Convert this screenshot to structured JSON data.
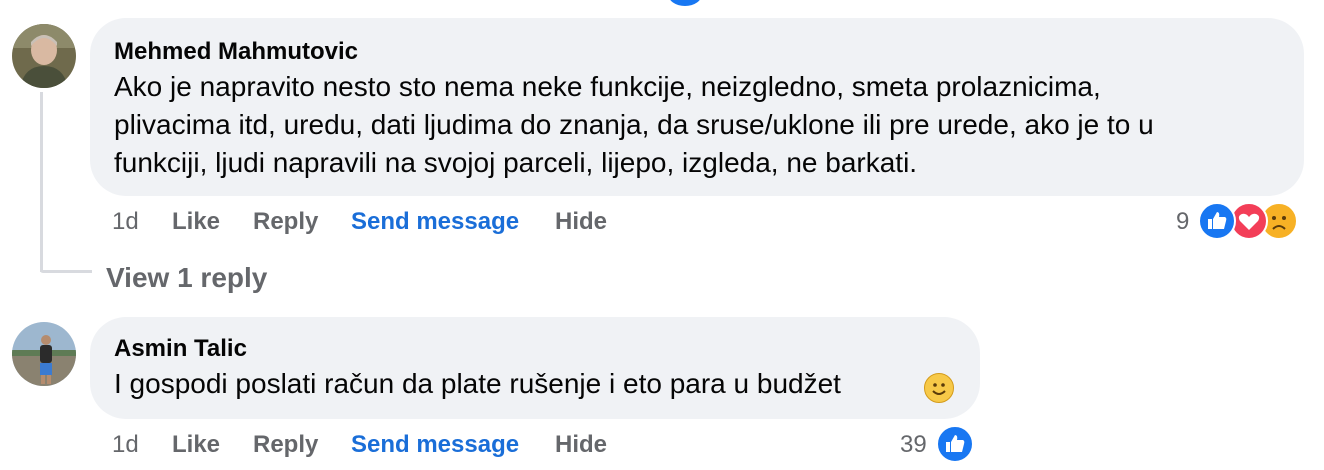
{
  "comments": [
    {
      "author": "Mehmed Mahmutovic",
      "lines": [
        "Ako je napravito nesto sto nema neke funkcije, neizgledno, smeta prolaznicima,",
        "plivacima itd, uredu, dati ljudima do znanja, da sruse/uklone ili pre urede, ako je to u",
        "funkciji, ljudi napravili na svojoj parceli, lijepo, izgleda, ne barkati."
      ],
      "time": "1d",
      "actions": {
        "like": "Like",
        "reply": "Reply",
        "send": "Send message",
        "hide": "Hide"
      },
      "reaction_count": "9",
      "reactions": [
        "like-reaction-icon",
        "love-reaction-icon",
        "sad-reaction-icon"
      ],
      "view_replies": "View 1 reply"
    },
    {
      "author": "Asmin Talic",
      "lines": [
        "I gospodi poslati račun da plate rušenje i eto para u budžet"
      ],
      "time": "1d",
      "actions": {
        "like": "Like",
        "reply": "Reply",
        "send": "Send message",
        "hide": "Hide"
      },
      "reaction_count": "39",
      "reactions": [
        "like-reaction-icon"
      ],
      "emoji": "smiling-face-icon"
    }
  ],
  "colors": {
    "bubble": "#f0f2f5",
    "link": "#1a6ed8",
    "muted": "#65676b",
    "like": "#1877f2",
    "love": "#f33e58"
  }
}
